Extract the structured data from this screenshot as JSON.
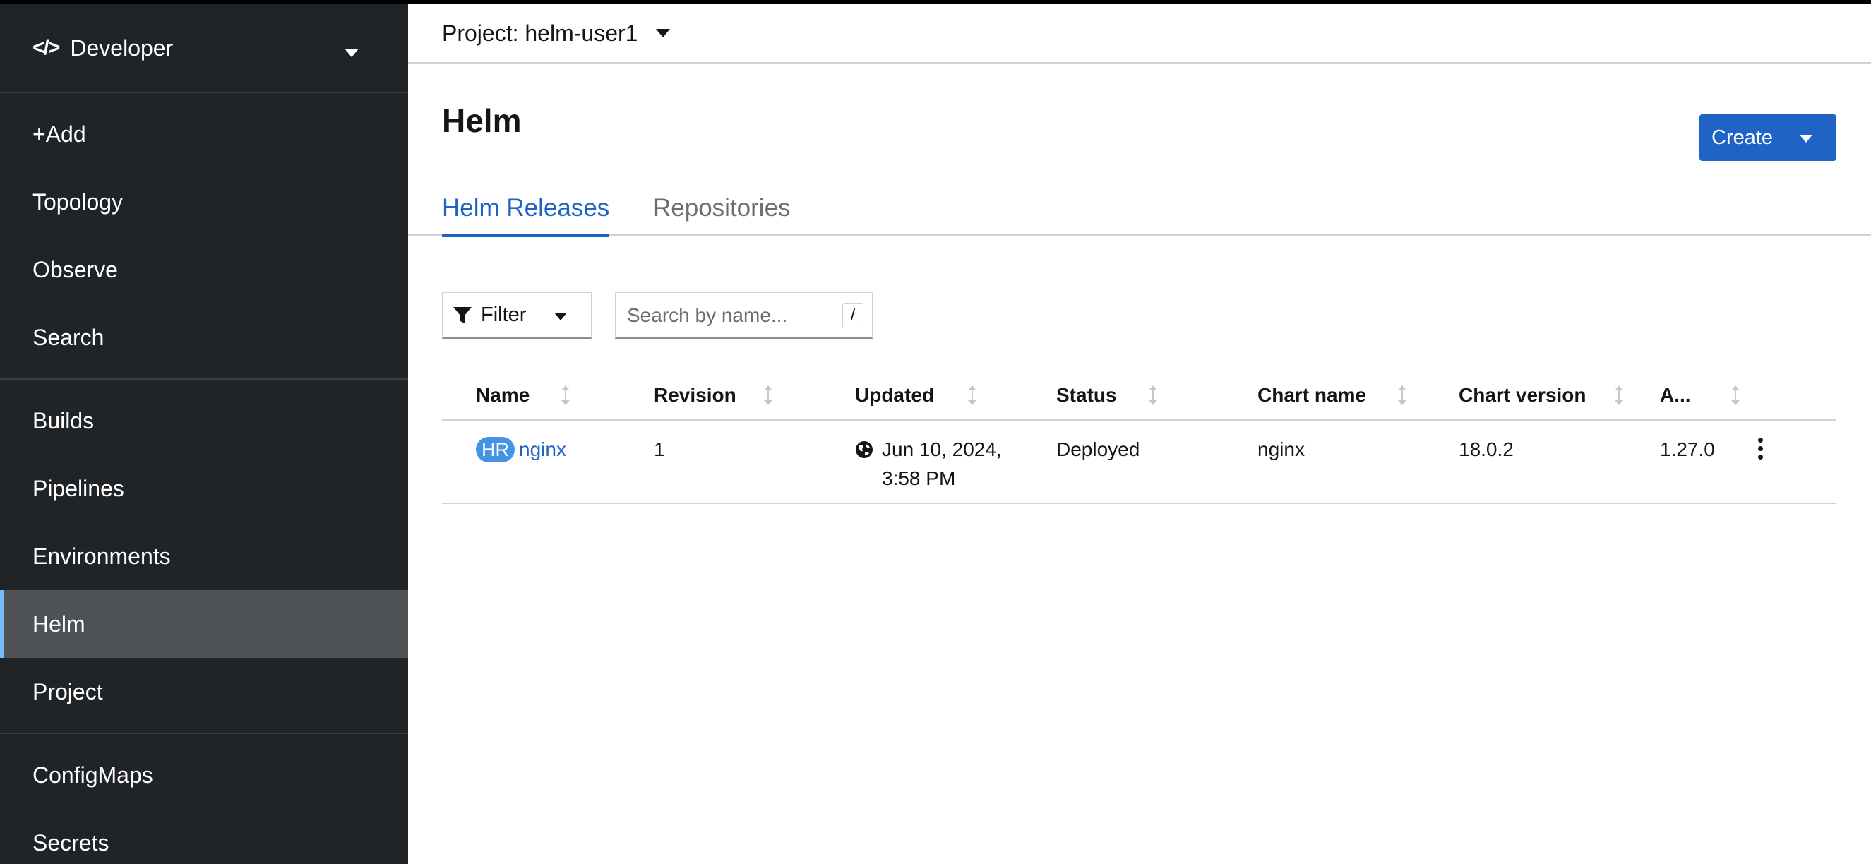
{
  "sidebar": {
    "perspective": {
      "label": "Developer",
      "icon": "code-icon"
    },
    "groups": [
      [
        "+Add",
        "Topology",
        "Observe",
        "Search"
      ],
      [
        "Builds",
        "Pipelines",
        "Environments",
        "Helm",
        "Project"
      ],
      [
        "ConfigMaps",
        "Secrets"
      ]
    ],
    "active": "Helm"
  },
  "project": {
    "label": "Project: helm-user1"
  },
  "page": {
    "title": "Helm",
    "create_label": "Create"
  },
  "tabs": [
    {
      "label": "Helm Releases",
      "active": true
    },
    {
      "label": "Repositories",
      "active": false
    }
  ],
  "toolbar": {
    "filter_label": "Filter",
    "search_placeholder": "Search by name...",
    "search_hint": "/"
  },
  "table": {
    "columns": [
      "Name",
      "Revision",
      "Updated",
      "Status",
      "Chart name",
      "Chart version",
      "A..."
    ],
    "rows": [
      {
        "badge": "HR",
        "name": "nginx",
        "revision": "1",
        "updated_line1": "Jun 10, 2024,",
        "updated_line2": "3:58 PM",
        "status": "Deployed",
        "chart_name": "nginx",
        "chart_version": "18.0.2",
        "app_version": "1.27.0"
      }
    ]
  },
  "colors": {
    "accent": "#1f63c6",
    "sidebar_bg": "#212427",
    "active_bar": "#73bcf7"
  }
}
